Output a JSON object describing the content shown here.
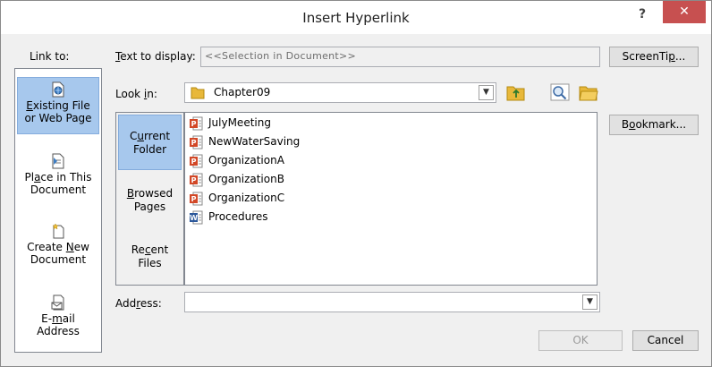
{
  "window": {
    "title": "Insert Hyperlink",
    "help_label": "?",
    "close_label": "✕"
  },
  "link_to": {
    "label": "Link to:",
    "items": [
      {
        "line1": "Existing File",
        "line2": "or Web Page",
        "icon": "web-page-icon"
      },
      {
        "line1": "Place in This",
        "line2": "Document",
        "icon": "document-place-icon"
      },
      {
        "line1": "Create New",
        "line2": "Document",
        "icon": "new-document-icon"
      },
      {
        "line1": "E-mail",
        "line2": "Address",
        "icon": "email-icon"
      }
    ]
  },
  "text_to_display": {
    "label": "Text to display:",
    "value": "<<Selection in Document>>"
  },
  "screentip_button": "ScreenTip...",
  "look_in": {
    "label": "Look in:",
    "value": "Chapter09"
  },
  "bookmark_button": "Bookmark...",
  "subnav": [
    {
      "line1": "Current",
      "line2": "Folder"
    },
    {
      "line1": "Browsed",
      "line2": "Pages"
    },
    {
      "line1": "Recent",
      "line2": "Files"
    }
  ],
  "files": [
    {
      "name": "JulyMeeting",
      "type": "powerpoint"
    },
    {
      "name": "NewWaterSaving",
      "type": "powerpoint"
    },
    {
      "name": "OrganizationA",
      "type": "powerpoint"
    },
    {
      "name": "OrganizationB",
      "type": "powerpoint"
    },
    {
      "name": "OrganizationC",
      "type": "powerpoint"
    },
    {
      "name": "Procedures",
      "type": "word"
    }
  ],
  "address": {
    "label": "Address:",
    "value": ""
  },
  "ok_button": "OK",
  "cancel_button": "Cancel",
  "colors": {
    "selected": "#a7c8ed",
    "close": "#c75050",
    "ppt": "#d24726",
    "word": "#2b579a",
    "folder": "#e8b83a"
  }
}
